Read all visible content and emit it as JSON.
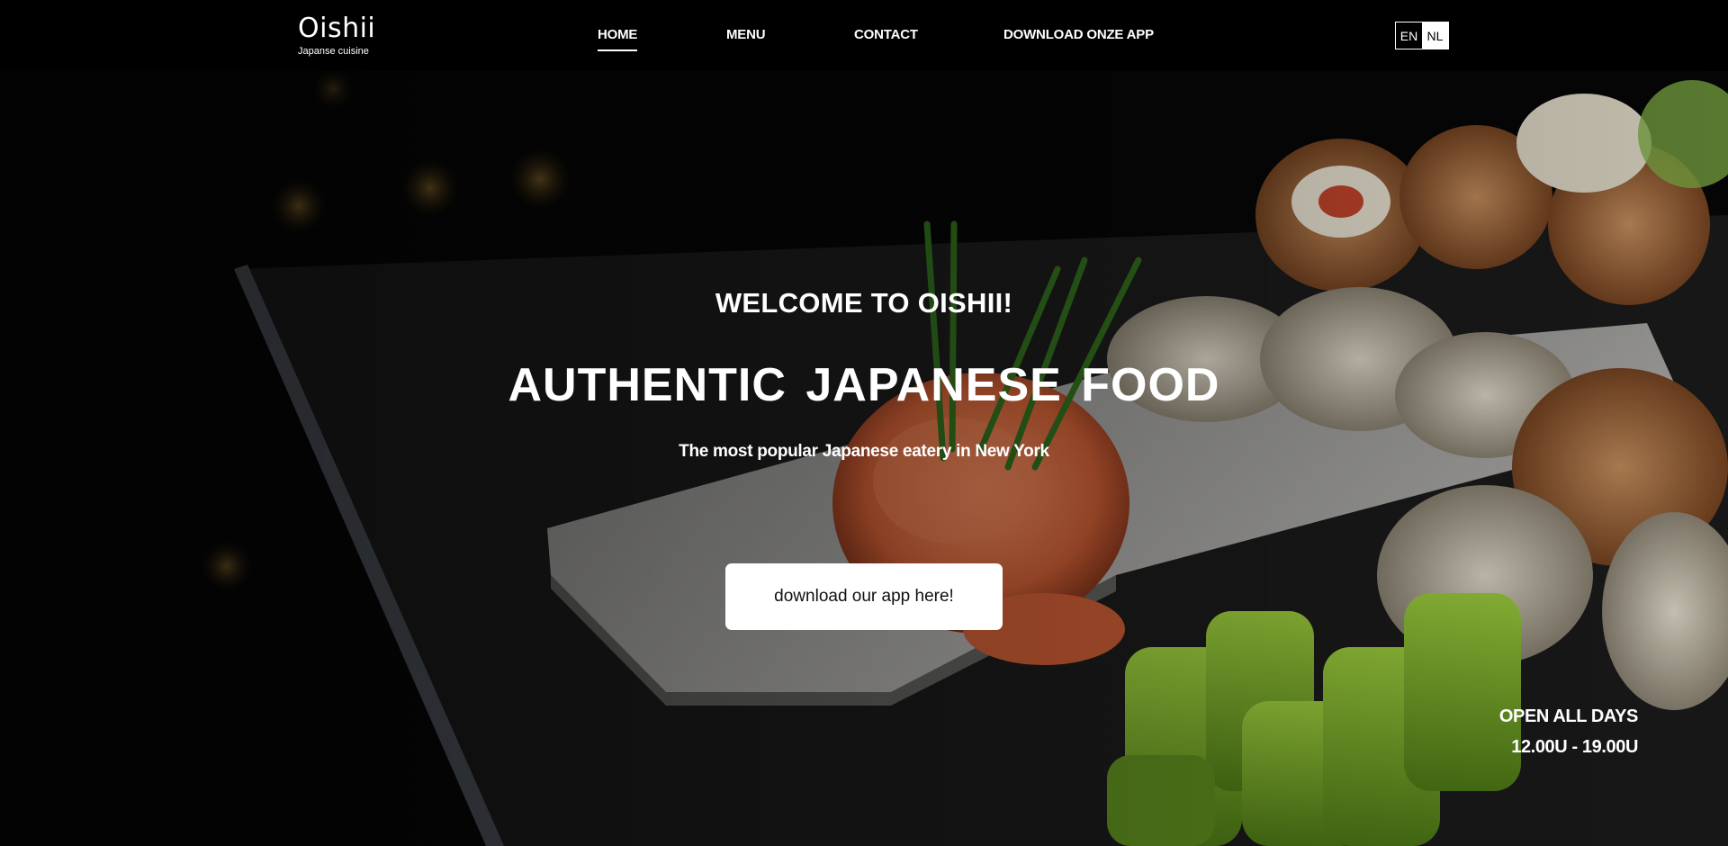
{
  "brand": {
    "name": "Oishii",
    "tagline": "Japanse cuisine"
  },
  "nav": {
    "items": [
      {
        "label": "HOME",
        "active": true
      },
      {
        "label": "MENU",
        "active": false
      },
      {
        "label": "CONTACT",
        "active": false
      },
      {
        "label": "DOWNLOAD ONZE APP",
        "active": false
      }
    ]
  },
  "language": {
    "options": [
      "EN",
      "NL"
    ],
    "selected": "NL"
  },
  "hero": {
    "welcome": "WELCOME TO OISHII!",
    "headline": "AUTHENTIC JAPANESE FOOD",
    "subline": "The most popular Japanese eatery in New York",
    "cta_label": "download our app here!",
    "hours_title": "OPEN ALL DAYS",
    "hours_time": "12.00U - 19.00U"
  },
  "colors": {
    "background": "#000000",
    "text": "#ffffff",
    "button_bg": "#ffffff",
    "button_text": "#111111"
  }
}
